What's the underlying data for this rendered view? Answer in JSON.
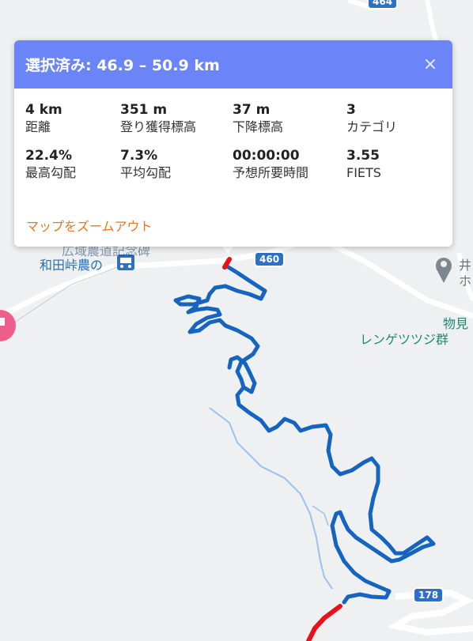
{
  "panel": {
    "title": "選択済み: 46.9 – 50.9 km",
    "close_symbol": "×",
    "stats": [
      {
        "value": "4 km",
        "label": "距離"
      },
      {
        "value": "351 m",
        "label": "登り獲得標高"
      },
      {
        "value": "37 m",
        "label": "下降標高"
      },
      {
        "value": "3",
        "label": "カテゴリ"
      },
      {
        "value": "22.4%",
        "label": "最高勾配"
      },
      {
        "value": "7.3%",
        "label": "平均勾配"
      },
      {
        "value": "00:00:00",
        "label": "予想所要時間"
      },
      {
        "value": "3.55",
        "label": "FIETS"
      }
    ],
    "zoom_link": "マップをズームアウト"
  },
  "map": {
    "place_wadatoge": "和田峠農の",
    "place_monomi": "物見",
    "place_renge": "レンゲツツジ群",
    "place_i": "井",
    "place_ho": "ホ",
    "road_460": "460",
    "road_178": "178",
    "road_464": "464",
    "cut_label": "広域農道記念碑"
  },
  "colors": {
    "route_selected": "#1565c0",
    "route_other": "#e8101a",
    "header": "#6b84f8",
    "link": "#e6761f",
    "stream": "#9cc0f0"
  }
}
